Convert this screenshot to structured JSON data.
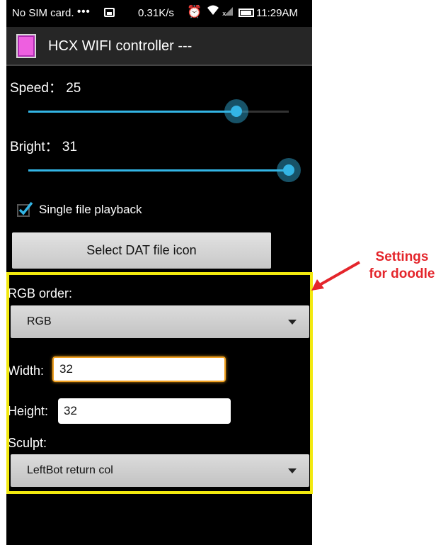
{
  "status_bar": {
    "carrier": "No SIM card.",
    "dots": "•••",
    "net_speed": "0.31K/s",
    "time": "11:29AM",
    "icons": [
      "image-icon",
      "alarm-icon",
      "wifi-icon",
      "signal-icon",
      "battery-icon"
    ]
  },
  "app": {
    "title": "HCX WIFI controller ---",
    "icon_color": "#ee5fe0"
  },
  "speed": {
    "label": "Speed：",
    "value": "25",
    "level": 0.8
  },
  "bright": {
    "label": "Bright：",
    "value": "31",
    "level": 1.0
  },
  "checkbox": {
    "label": "Single file playback",
    "checked": true
  },
  "select_button": {
    "label": "Select DAT file icon"
  },
  "rgb_order": {
    "label": "RGB order:",
    "selected": "RGB"
  },
  "width": {
    "label": "Width:",
    "value": "32"
  },
  "height": {
    "label": "Height:",
    "value": "32"
  },
  "sculpt": {
    "label": "Sculpt:",
    "selected": "LeftBot return col"
  },
  "annotation": {
    "line1": "Settings",
    "line2": "for doodle",
    "color": "#e4252b",
    "box_color": "#f2e90f"
  },
  "colors": {
    "accent": "#33b5e5",
    "background": "#000000"
  }
}
